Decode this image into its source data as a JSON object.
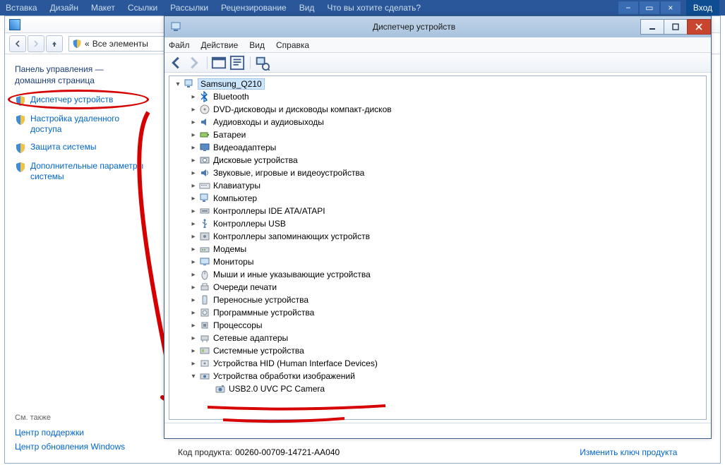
{
  "ribbon": {
    "tabs": [
      "Вставка",
      "Дизайн",
      "Макет",
      "Ссылки",
      "Рассылки",
      "Рецензирование",
      "Вид",
      "Что вы хотите сделать?"
    ],
    "login": "Вход"
  },
  "control_panel": {
    "breadcrumb_prefix": "«",
    "breadcrumb": "Все элементы",
    "heading_line1": "Панель управления —",
    "heading_line2": "домашняя страница",
    "links": {
      "device_manager": "Диспетчер устройств",
      "remote": "Настройка удаленного доступа",
      "protection": "Защита системы",
      "advanced": "Дополнительные параметры системы"
    },
    "see_also": "См. также",
    "action_center": "Центр поддержки",
    "windows_update": "Центр обновления Windows",
    "product_key_label": "Код продукта:",
    "product_key_value": "00260-00709-14721-AA040",
    "change_key": "Изменить ключ продукта"
  },
  "device_manager": {
    "title": "Диспетчер устройств",
    "menu": {
      "file": "Файл",
      "action": "Действие",
      "view": "Вид",
      "help": "Справка"
    },
    "root": "Samsung_Q210",
    "categories": [
      {
        "label": "Bluetooth",
        "icon": "bluetooth"
      },
      {
        "label": "DVD-дисководы и дисководы компакт-дисков",
        "icon": "disc"
      },
      {
        "label": "Аудиовходы и аудиовыходы",
        "icon": "audio"
      },
      {
        "label": "Батареи",
        "icon": "battery"
      },
      {
        "label": "Видеоадаптеры",
        "icon": "display"
      },
      {
        "label": "Дисковые устройства",
        "icon": "disk"
      },
      {
        "label": "Звуковые, игровые и видеоустройства",
        "icon": "sound"
      },
      {
        "label": "Клавиатуры",
        "icon": "keyboard"
      },
      {
        "label": "Компьютер",
        "icon": "computer"
      },
      {
        "label": "Контроллеры IDE ATA/ATAPI",
        "icon": "ide"
      },
      {
        "label": "Контроллеры USB",
        "icon": "usb"
      },
      {
        "label": "Контроллеры запоминающих устройств",
        "icon": "storage"
      },
      {
        "label": "Модемы",
        "icon": "modem"
      },
      {
        "label": "Мониторы",
        "icon": "monitor"
      },
      {
        "label": "Мыши и иные указывающие устройства",
        "icon": "mouse"
      },
      {
        "label": "Очереди печати",
        "icon": "printer"
      },
      {
        "label": "Переносные устройства",
        "icon": "portable"
      },
      {
        "label": "Программные устройства",
        "icon": "software"
      },
      {
        "label": "Процессоры",
        "icon": "cpu"
      },
      {
        "label": "Сетевые адаптеры",
        "icon": "network"
      },
      {
        "label": "Системные устройства",
        "icon": "system"
      },
      {
        "label": "Устройства HID (Human Interface Devices)",
        "icon": "hid"
      },
      {
        "label": "Устройства обработки изображений",
        "icon": "imaging",
        "expanded": true,
        "children": [
          {
            "label": "USB2.0 UVC PC Camera",
            "icon": "camera"
          }
        ]
      }
    ]
  }
}
